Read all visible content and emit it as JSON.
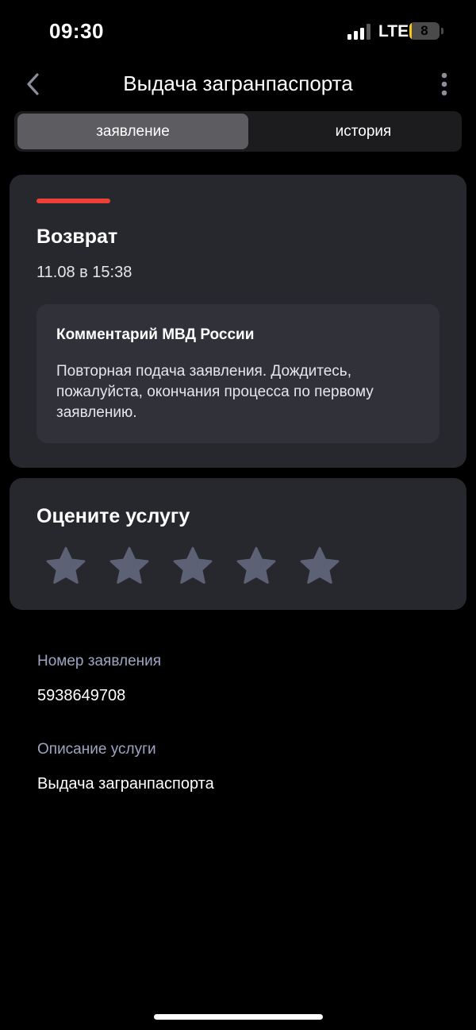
{
  "status_bar": {
    "time": "09:30",
    "network": "LTE",
    "battery_level": "8",
    "battery_fraction": 0.08,
    "battery_color": "#f5c518",
    "signal_icon": "cellular-signal-icon"
  },
  "nav": {
    "back_icon": "chevron-left-icon",
    "title": "Выдача загранпаспорта",
    "more_icon": "more-vertical-icon"
  },
  "tabs": [
    {
      "label": "заявление",
      "selected": true
    },
    {
      "label": "история",
      "selected": false
    }
  ],
  "status_card": {
    "accent_color": "#ee3f37",
    "status": "Возврат",
    "datetime": "11.08 в 15:38",
    "comment": {
      "title": "Комментарий МВД России",
      "text": "Повторная подача заявления. Дождитесь, пожалуйста, окончания процесса по первому заявлению."
    }
  },
  "rating": {
    "title": "Оцените услугу",
    "star_icon": "star-icon",
    "max_stars": 5,
    "selected": 0,
    "star_color": "#5c6175"
  },
  "details": [
    {
      "label": "Номер заявления",
      "value": "5938649708"
    },
    {
      "label": "Описание услуги",
      "value": "Выдача загранпаспорта"
    }
  ]
}
